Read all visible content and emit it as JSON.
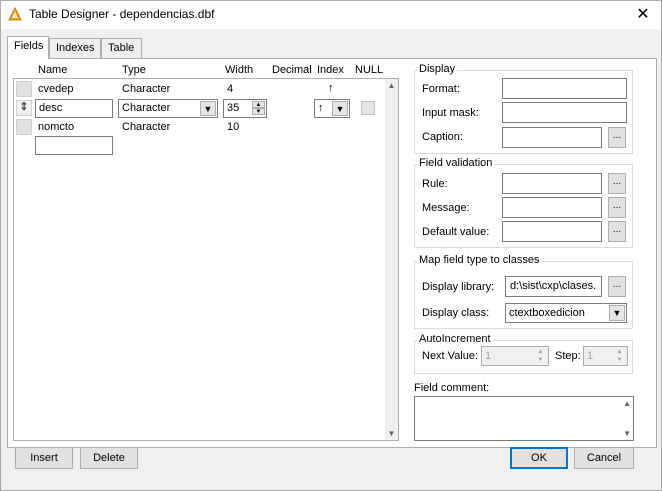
{
  "window": {
    "title": "Table Designer - dependencias.dbf",
    "close_glyph": "✕"
  },
  "tabs": [
    {
      "label": "Fields",
      "active": true
    },
    {
      "label": "Indexes",
      "active": false
    },
    {
      "label": "Table",
      "active": false
    }
  ],
  "grid": {
    "headers": {
      "name": "Name",
      "type": "Type",
      "width": "Width",
      "decimal": "Decimal",
      "index": "Index",
      "null": "NULL"
    },
    "rows": [
      {
        "name": "cvedep",
        "type": "Character",
        "width": "4",
        "decimal": "",
        "index": "↑"
      },
      {
        "name": "desc",
        "type": "Character",
        "width": "35",
        "decimal": "",
        "index": "↑",
        "editing": true
      },
      {
        "name": "nomcto",
        "type": "Character",
        "width": "10",
        "decimal": "",
        "index": ""
      },
      {
        "name": "",
        "type": "",
        "width": "",
        "decimal": "",
        "index": "",
        "new_row": true
      }
    ],
    "current_row_glyph": "⇕"
  },
  "display": {
    "title": "Display",
    "format_label": "Format:",
    "format_value": "",
    "input_mask_label": "Input mask:",
    "input_mask_value": "",
    "caption_label": "Caption:",
    "caption_value": ""
  },
  "validation": {
    "title": "Field validation",
    "rule_label": "Rule:",
    "rule_value": "",
    "message_label": "Message:",
    "message_value": "",
    "default_label": "Default value:",
    "default_value": ""
  },
  "mapping": {
    "title": "Map field type to classes",
    "library_label": "Display library:",
    "library_value": "d:\\sist\\cxp\\clases.",
    "class_label": "Display class:",
    "class_value": "ctextboxedicion"
  },
  "autoinc": {
    "title": "AutoIncrement",
    "next_label": "Next Value:",
    "next_value": "1",
    "step_label": "Step:",
    "step_value": "1"
  },
  "comment": {
    "label": "Field comment:",
    "value": ""
  },
  "buttons": {
    "insert": "Insert",
    "delete": "Delete",
    "ok": "OK",
    "cancel": "Cancel",
    "ellipsis": "..."
  },
  "colors": {
    "accent": "#0078d7",
    "title_icon": "#f5a623"
  }
}
